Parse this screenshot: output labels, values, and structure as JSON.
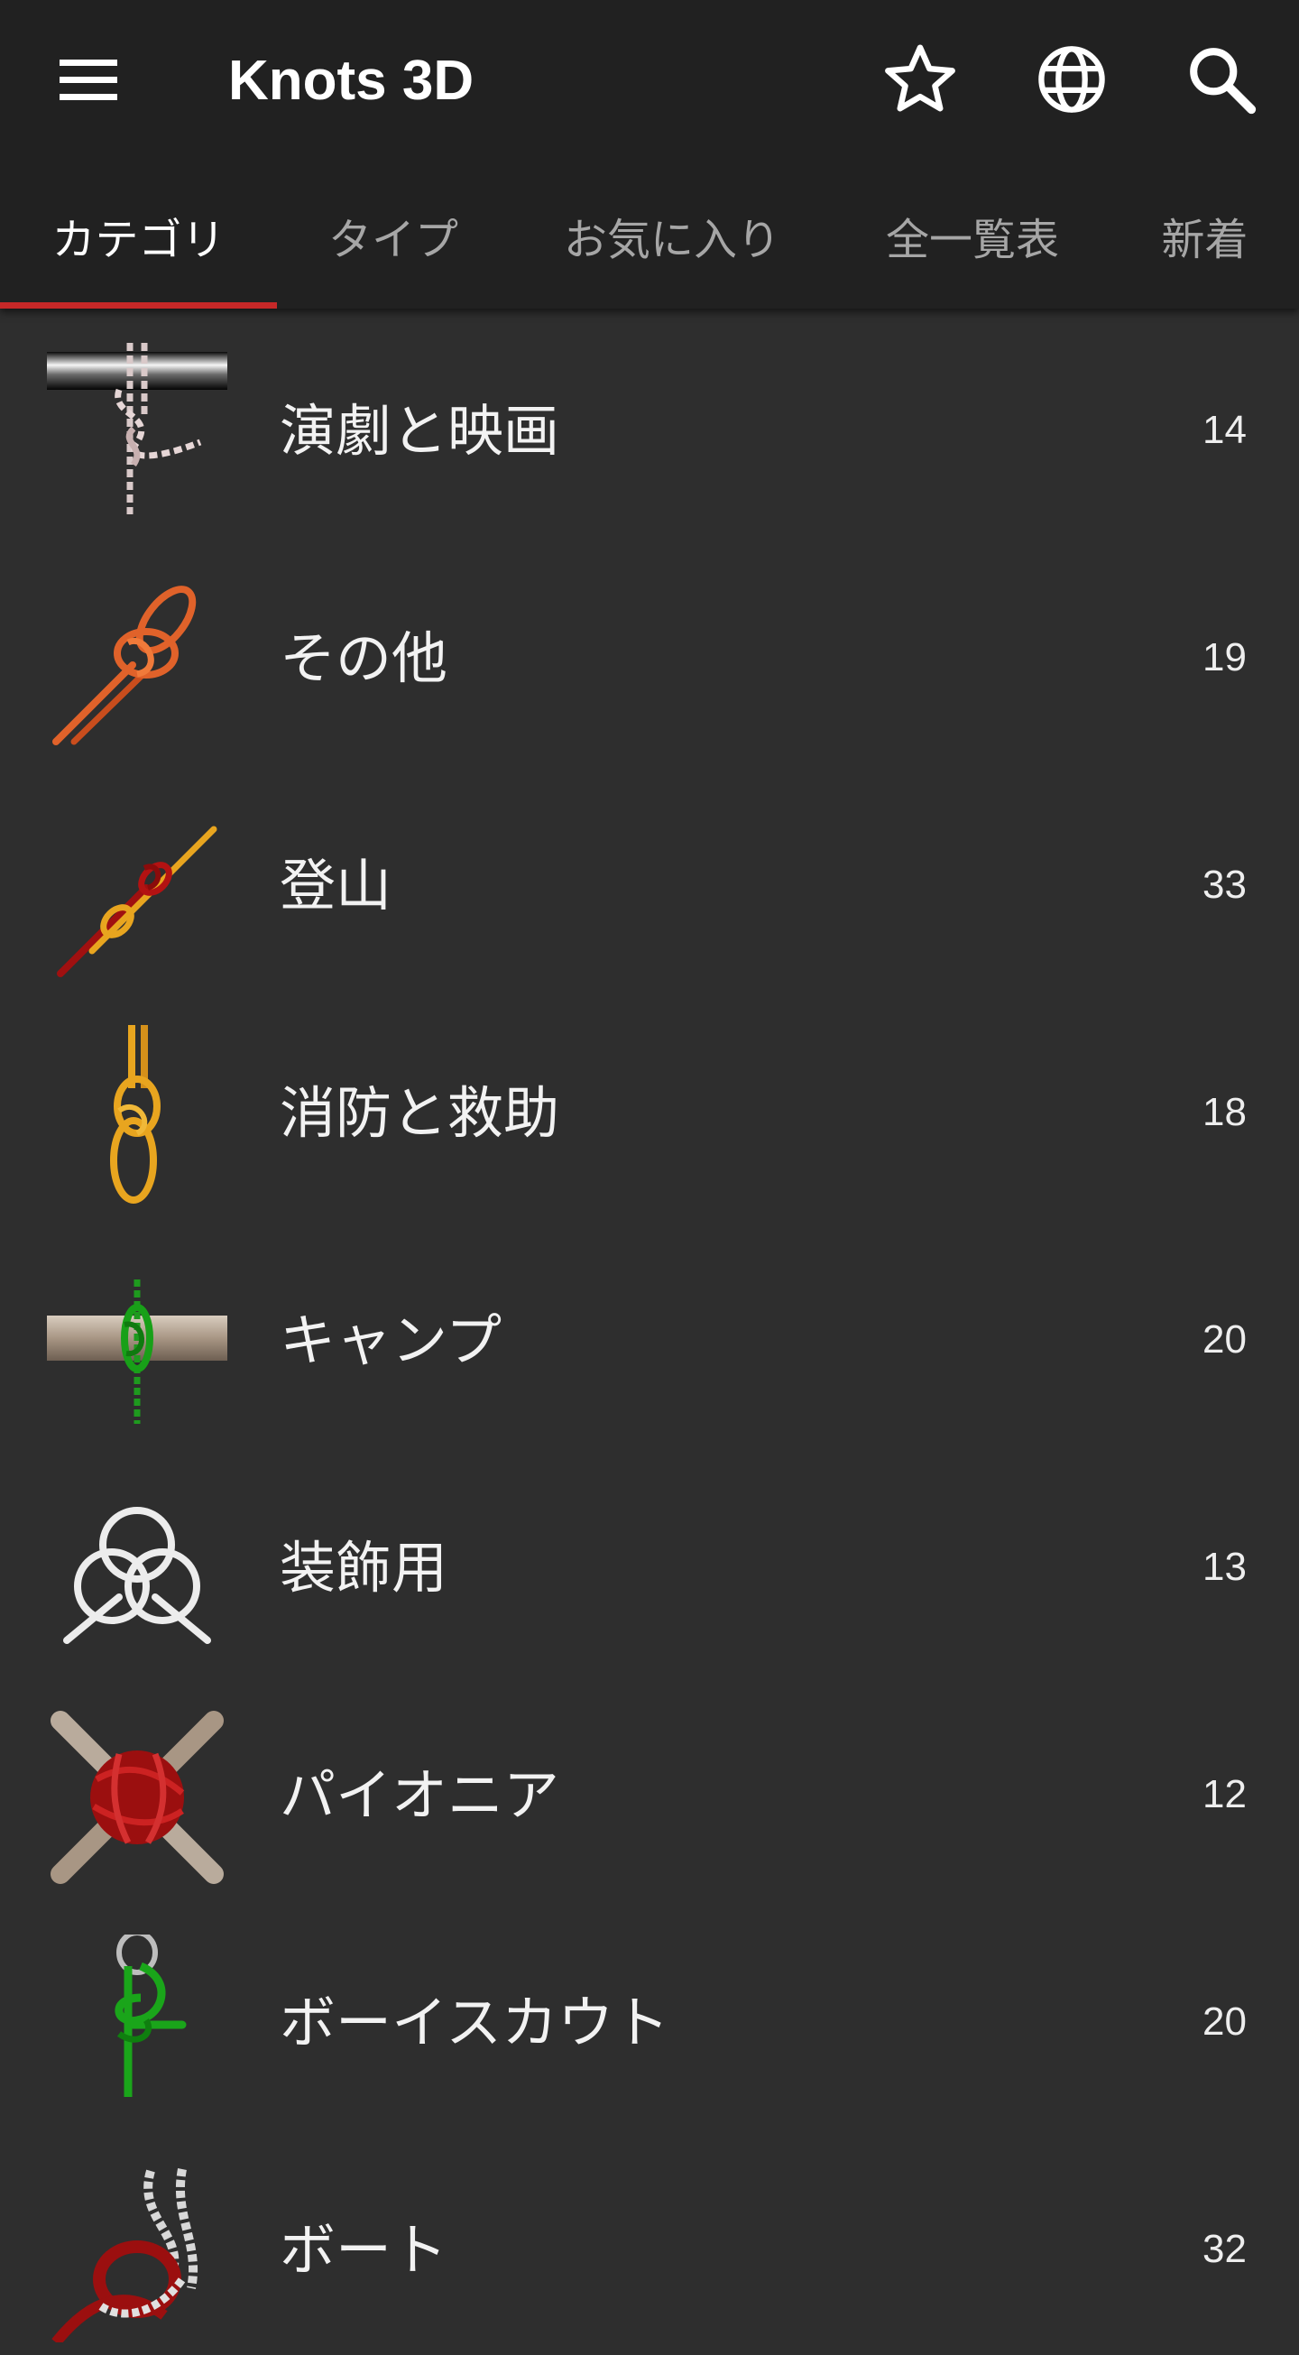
{
  "app": {
    "title": "Knots 3D"
  },
  "toolbar": {
    "menu_icon": "menu-icon",
    "favorite_icon": "star-outline-icon",
    "language_icon": "globe-icon",
    "search_icon": "search-icon"
  },
  "tabs": [
    {
      "label": "カテゴリ",
      "active": true
    },
    {
      "label": "タイプ",
      "active": false
    },
    {
      "label": "お気に入り",
      "active": false
    },
    {
      "label": "全一覧表",
      "active": false
    },
    {
      "label": "新着",
      "active": false
    }
  ],
  "categories": [
    {
      "label": "演劇と映画",
      "count": "14",
      "icon": "theater-knot-thumbnail"
    },
    {
      "label": "その他",
      "count": "19",
      "icon": "misc-knot-thumbnail"
    },
    {
      "label": "登山",
      "count": "33",
      "icon": "climbing-knot-thumbnail"
    },
    {
      "label": "消防と救助",
      "count": "18",
      "icon": "rescue-knot-thumbnail"
    },
    {
      "label": "キャンプ",
      "count": "20",
      "icon": "camping-knot-thumbnail"
    },
    {
      "label": "装飾用",
      "count": "13",
      "icon": "decorative-knot-thumbnail"
    },
    {
      "label": "パイオニア",
      "count": "12",
      "icon": "pioneer-knot-thumbnail"
    },
    {
      "label": "ボーイスカウト",
      "count": "20",
      "icon": "scout-knot-thumbnail"
    },
    {
      "label": "ボート",
      "count": "32",
      "icon": "boating-knot-thumbnail"
    }
  ],
  "colors": {
    "appbar": "#212121",
    "background": "#2e2e2e",
    "tab_indicator": "#c62828",
    "active_tab_text": "#ffffff",
    "inactive_tab_text": "#a6a6a6"
  }
}
